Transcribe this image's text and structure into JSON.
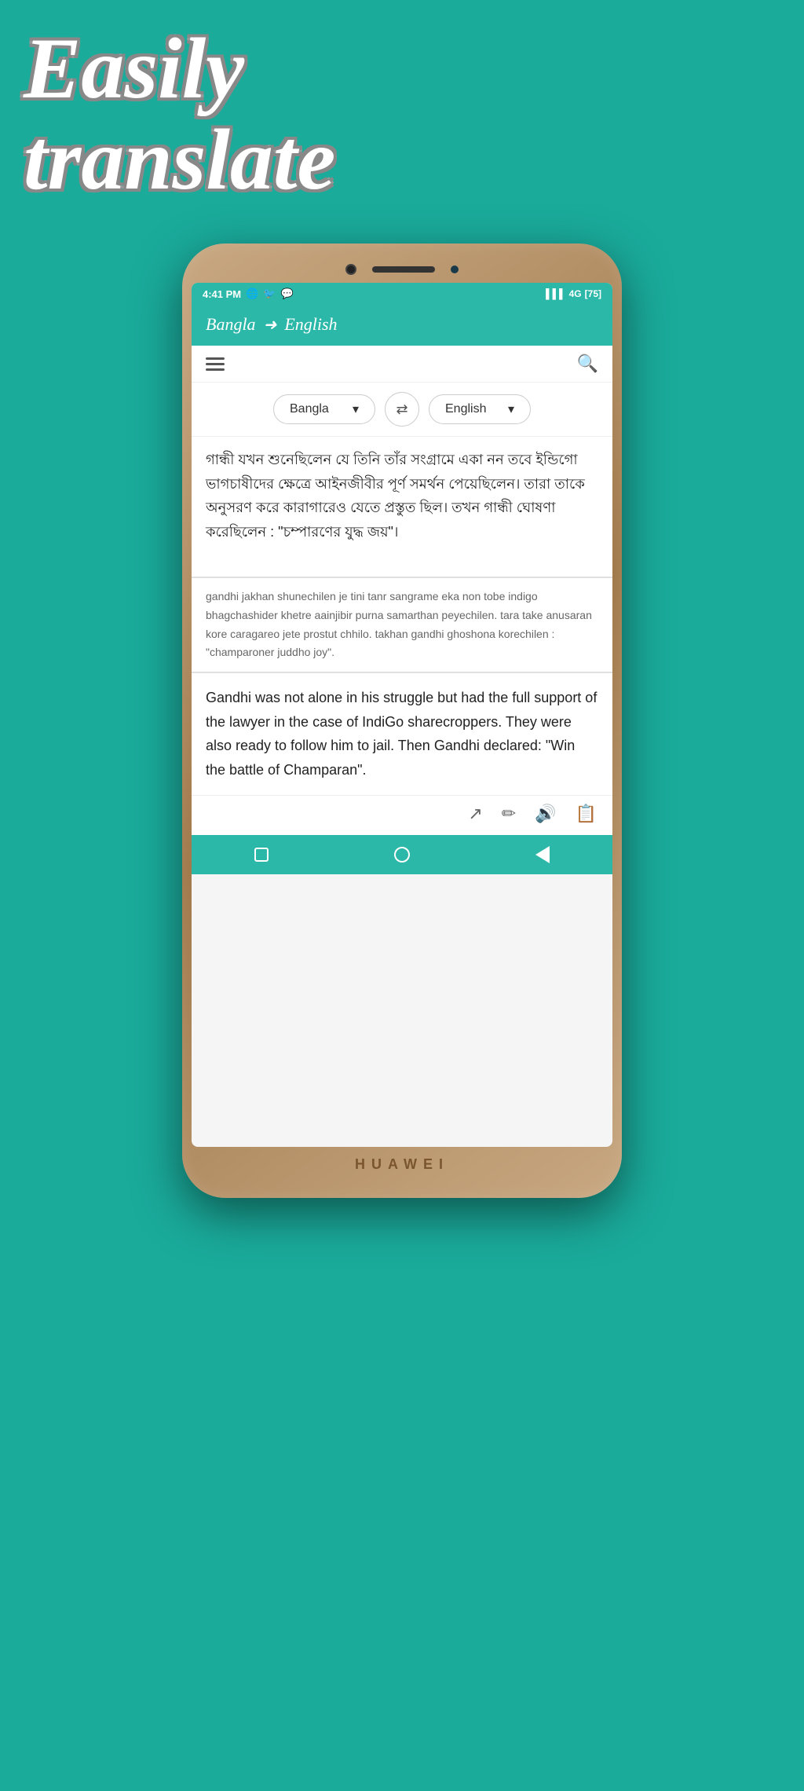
{
  "hero": {
    "line1": "Easily",
    "line2": "translate"
  },
  "status_bar": {
    "time": "4:41 PM",
    "network": "4G",
    "battery": "75"
  },
  "app_header": {
    "from_lang": "Bangla",
    "arrow": "➜",
    "to_lang": "English"
  },
  "toolbar": {
    "search_placeholder": "Search"
  },
  "language_selector": {
    "from": "Bangla",
    "to": "English",
    "swap_icon": "⇄"
  },
  "input": {
    "bangla_text": "গান্ধী যখন শুনেছিলেন যে তিনি তাঁর সংগ্রামে একা নন তবে ইন্ডিগো ভাগচাষীদের ক্ষেত্রে আইনজীবীর পূর্ণ সমর্থন পেয়েছিলেন। তারা তাকে অনুসরণ করে কারাগারেও যেতে প্রস্তুত ছিল। তখন গান্ধী ঘোষণা করেছিলেন : \"চম্পারণের যুদ্ধ জয়\"।"
  },
  "romanized": {
    "text": "gandhi jakhan shunechilen je tini tanr sangrame eka non tobe indigo bhagchashider khetre aainjibir purna samarthan peyechilen. tara take anusaran kore caragareo jete prostut chhilo. takhan gandhi ghoshona korechilen : \"champaroner juddho joy\"."
  },
  "translation": {
    "text": "Gandhi was not alone in his struggle but had the full support of the lawyer in the case of IndiGo sharecroppers. They were also ready to follow him to jail. Then Gandhi declared: \"Win the battle of Champaran\"."
  },
  "action_icons": {
    "expand": "↗",
    "edit": "✏",
    "speaker": "🔊",
    "copy": "📋"
  },
  "bottom_nav": {
    "square": "",
    "circle": "",
    "triangle": ""
  },
  "brand": "HUAWEI"
}
